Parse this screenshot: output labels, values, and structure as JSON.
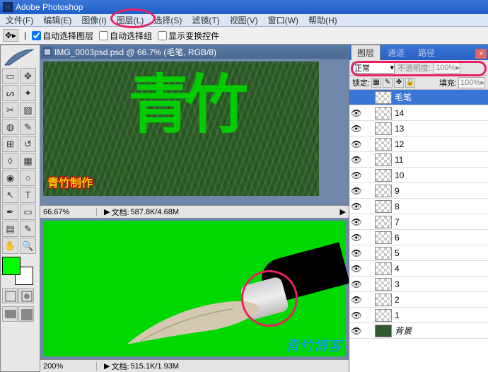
{
  "title": "Adobe Photoshop",
  "menu": [
    "文件(F)",
    "编辑(E)",
    "图像(I)",
    "图层(L)",
    "选择(S)",
    "滤镜(T)",
    "视图(V)",
    "窗口(W)",
    "帮助(H)"
  ],
  "options": {
    "auto_select_layer": "自动选择图层",
    "auto_select_group": "自动选择组",
    "show_transform": "显示变换控件"
  },
  "doc1": {
    "title": "IMG_0003psd.psd @ 66.7% (毛笔, RGB/8)",
    "zoom": "66.67%",
    "doclabel": "文档:",
    "doc": "587.8K/4.68M",
    "calli": "青竹",
    "stamp": "青竹制作"
  },
  "doc2": {
    "zoom": "200%",
    "doclabel": "文档:",
    "doc": "515.1K/1.93M"
  },
  "panels": {
    "tabs": [
      "图层",
      "通道",
      "路径"
    ],
    "blend": "正常",
    "opacity_label": "不透明度:",
    "opacity": "100%",
    "lock_label": "锁定:",
    "fill_label": "填充:",
    "fill": "100%",
    "layers": [
      {
        "name": "毛笔",
        "selected": true,
        "eye": false,
        "bg": false
      },
      {
        "name": "14",
        "selected": false,
        "eye": true,
        "bg": false
      },
      {
        "name": "13",
        "selected": false,
        "eye": true,
        "bg": false
      },
      {
        "name": "12",
        "selected": false,
        "eye": true,
        "bg": false
      },
      {
        "name": "11",
        "selected": false,
        "eye": true,
        "bg": false
      },
      {
        "name": "10",
        "selected": false,
        "eye": true,
        "bg": false
      },
      {
        "name": "9",
        "selected": false,
        "eye": true,
        "bg": false
      },
      {
        "name": "8",
        "selected": false,
        "eye": true,
        "bg": false
      },
      {
        "name": "7",
        "selected": false,
        "eye": true,
        "bg": false
      },
      {
        "name": "6",
        "selected": false,
        "eye": true,
        "bg": false
      },
      {
        "name": "5",
        "selected": false,
        "eye": true,
        "bg": false
      },
      {
        "name": "4",
        "selected": false,
        "eye": true,
        "bg": false
      },
      {
        "name": "3",
        "selected": false,
        "eye": true,
        "bg": false
      },
      {
        "name": "2",
        "selected": false,
        "eye": true,
        "bg": false
      },
      {
        "name": "1",
        "selected": false,
        "eye": true,
        "bg": false
      },
      {
        "name": "背景",
        "selected": false,
        "eye": true,
        "bg": true
      }
    ]
  },
  "watermark": "青竹博客"
}
